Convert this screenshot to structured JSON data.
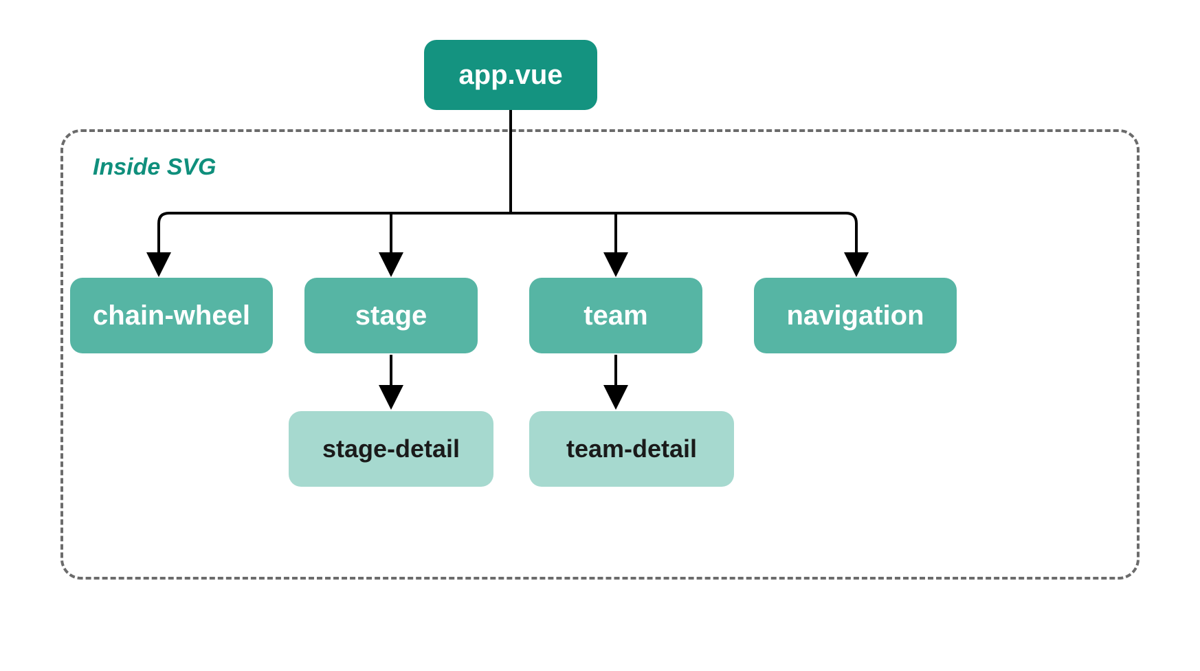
{
  "diagram": {
    "container_label": "Inside SVG",
    "root": {
      "label": "app.vue"
    },
    "level1": {
      "chain_wheel": {
        "label": "chain-wheel"
      },
      "stage": {
        "label": "stage"
      },
      "team": {
        "label": "team"
      },
      "navigation": {
        "label": "navigation"
      }
    },
    "level2": {
      "stage_detail": {
        "label": "stage-detail"
      },
      "team_detail": {
        "label": "team-detail"
      }
    },
    "edges": [
      {
        "from": "root",
        "to": "chain_wheel"
      },
      {
        "from": "root",
        "to": "stage"
      },
      {
        "from": "root",
        "to": "team"
      },
      {
        "from": "root",
        "to": "navigation"
      },
      {
        "from": "stage",
        "to": "stage_detail"
      },
      {
        "from": "team",
        "to": "team_detail"
      }
    ],
    "colors": {
      "node_dark": "#149380",
      "node_mid": "#56b5a4",
      "node_light": "#a6d9cf",
      "dashed_border": "#6b6b6b",
      "label_teal": "#0f8f7c",
      "arrow": "#000000"
    }
  }
}
